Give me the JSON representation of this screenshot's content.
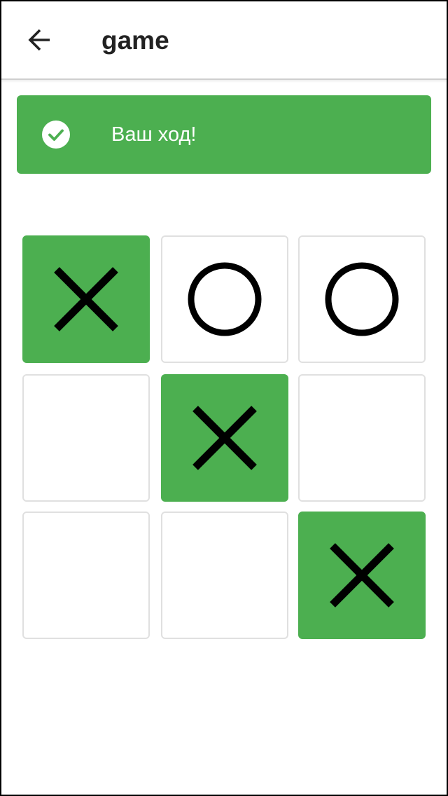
{
  "header": {
    "title": "game",
    "back_icon": "arrow-left-icon"
  },
  "banner": {
    "message": "Ваш ход!",
    "icon": "check-circle-icon",
    "color": "#4CAF50"
  },
  "board": {
    "cells": [
      {
        "mark": "X",
        "highlight": true
      },
      {
        "mark": "O",
        "highlight": false
      },
      {
        "mark": "O",
        "highlight": false
      },
      {
        "mark": "",
        "highlight": false
      },
      {
        "mark": "X",
        "highlight": true
      },
      {
        "mark": "",
        "highlight": false
      },
      {
        "mark": "",
        "highlight": false
      },
      {
        "mark": "",
        "highlight": false
      },
      {
        "mark": "X",
        "highlight": true
      }
    ],
    "highlight_color": "#4CAF50",
    "mark_color": "#000000"
  }
}
